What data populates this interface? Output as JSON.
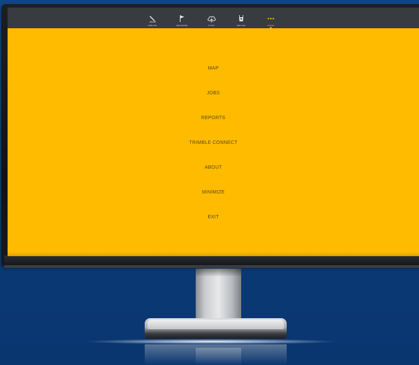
{
  "toolbar": {
    "tabs": [
      {
        "id": "create",
        "label": "CREATE",
        "icon": "pen-icon",
        "active": false
      },
      {
        "id": "measure",
        "label": "MEASURE",
        "icon": "flag-icon",
        "active": false
      },
      {
        "id": "sync",
        "label": "SYNC",
        "icon": "cloud-sync-icon",
        "active": false
      },
      {
        "id": "device",
        "label": "DEVICE",
        "icon": "device-icon",
        "active": false
      },
      {
        "id": "more",
        "label": "MORE",
        "icon": "more-dots-icon",
        "active": true
      }
    ]
  },
  "menu": {
    "items": [
      "MAP",
      "JOBS",
      "REPORTS",
      "TRIMBLE CONNECT",
      "ABOUT",
      "MINIMIZE",
      "EXIT"
    ]
  },
  "colors": {
    "accent": "#ffbb00",
    "toolbar_bg": "#383b40",
    "menu_text": "#5b4a1e",
    "background": "#0e3f7c"
  }
}
